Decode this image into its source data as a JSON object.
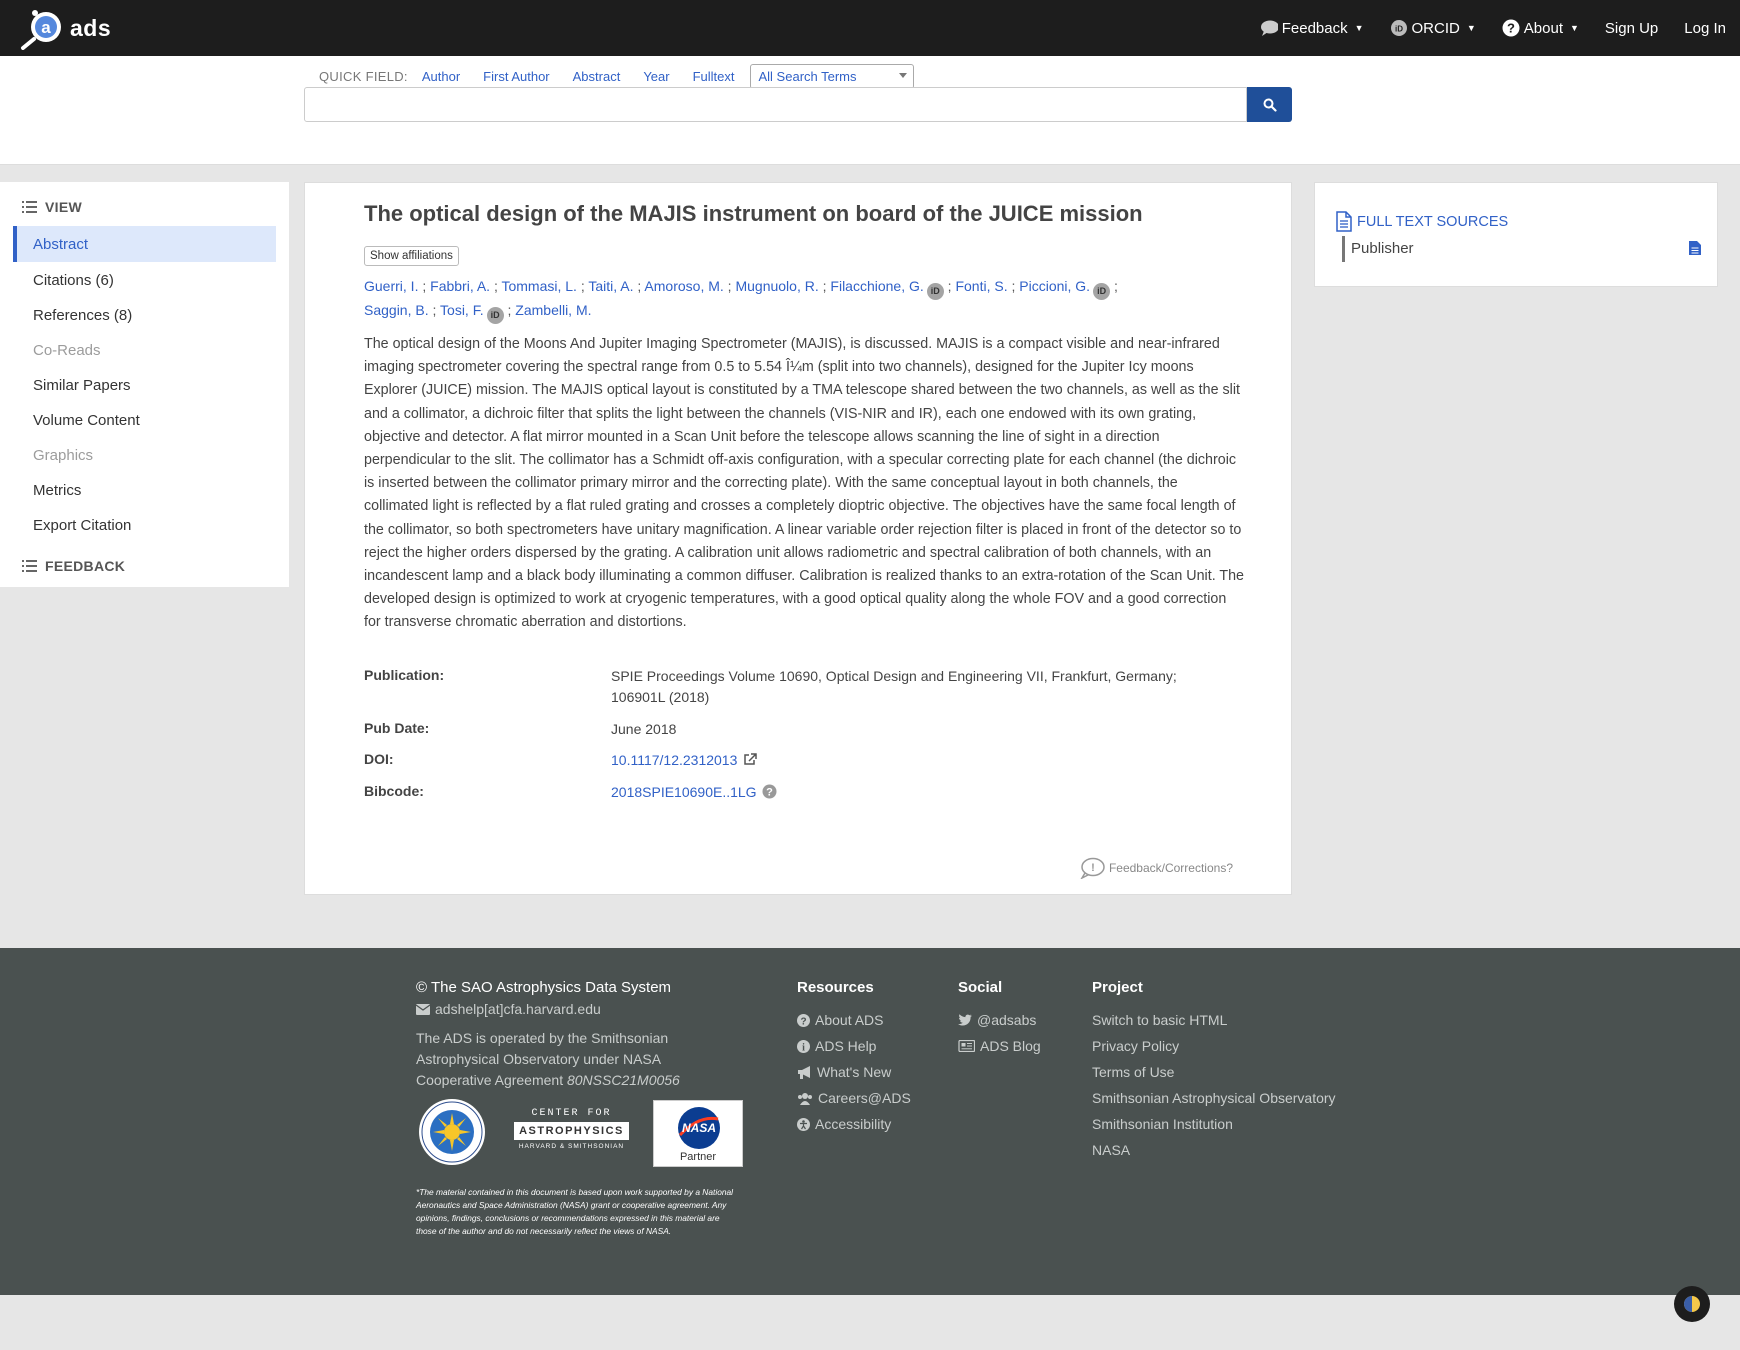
{
  "nav": {
    "logo": "ads",
    "feedback": "Feedback",
    "orcid": "ORCID",
    "about": "About",
    "signup": "Sign Up",
    "login": "Log In"
  },
  "search": {
    "quickfield_label": "QUICK FIELD:",
    "fields": [
      "Author",
      "First Author",
      "Abstract",
      "Year",
      "Fulltext"
    ],
    "select_value": "All Search Terms",
    "query": ""
  },
  "sidebar": {
    "view_heading": "VIEW",
    "feedback_heading": "FEEDBACK",
    "items": [
      {
        "label": "Abstract",
        "state": "active"
      },
      {
        "label": "Citations (6)",
        "state": "enabled"
      },
      {
        "label": "References (8)",
        "state": "enabled"
      },
      {
        "label": "Co-Reads",
        "state": "disabled"
      },
      {
        "label": "Similar Papers",
        "state": "enabled"
      },
      {
        "label": "Volume Content",
        "state": "enabled"
      },
      {
        "label": "Graphics",
        "state": "disabled"
      },
      {
        "label": "Metrics",
        "state": "enabled"
      },
      {
        "label": "Export Citation",
        "state": "enabled"
      }
    ]
  },
  "paper": {
    "title": "The optical design of the MAJIS instrument on board of the JUICE mission",
    "show_affiliations": "Show affiliations",
    "authors_line1": [
      {
        "name": "Guerri, I.",
        "orcid": false
      },
      {
        "name": "Fabbri, A.",
        "orcid": false
      },
      {
        "name": "Tommasi, L.",
        "orcid": false
      },
      {
        "name": "Taiti, A.",
        "orcid": false
      },
      {
        "name": "Amoroso, M.",
        "orcid": false
      },
      {
        "name": "Mugnuolo, R.",
        "orcid": false
      },
      {
        "name": "Filacchione, G.",
        "orcid": true
      },
      {
        "name": "Fonti, S.",
        "orcid": false
      },
      {
        "name": "Piccioni, G.",
        "orcid": true
      }
    ],
    "authors_line2": [
      {
        "name": "Saggin, B.",
        "orcid": false
      },
      {
        "name": "Tosi, F.",
        "orcid": true
      },
      {
        "name": "Zambelli, M.",
        "orcid": false
      }
    ],
    "abstract": "The optical design of the Moons And Jupiter Imaging Spectrometer (MAJIS), is discussed. MAJIS is a compact visible and near-infrared imaging spectrometer covering the spectral range from 0.5 to 5.54 Î¼m (split into two channels), designed for the Jupiter Icy moons Explorer (JUICE) mission. The MAJIS optical layout is constituted by a TMA telescope shared between the two channels, as well as the slit and a collimator, a dichroic filter that splits the light between the channels (VIS-NIR and IR), each one endowed with its own grating, objective and detector. A flat mirror mounted in a Scan Unit before the telescope allows scanning the line of sight in a direction perpendicular to the slit. The collimator has a Schmidt off-axis configuration, with a specular correcting plate for each channel (the dichroic is inserted between the collimator primary mirror and the correcting plate). With the same conceptual layout in both channels, the collimated light is reflected by a flat ruled grating and crosses a completely dioptric objective. The objectives have the same focal length of the collimator, so both spectrometers have unitary magnification. A linear variable order rejection filter is placed in front of the detector so to reject the higher orders dispersed by the grating. A calibration unit allows radiometric and spectral calibration of both channels, with an incandescent lamp and a black body illuminating a common diffuser. Calibration is realized thanks to an extra-rotation of the Scan Unit. The developed design is optimized to work at cryogenic temperatures, with a good optical quality along the whole FOV and a good correction for transverse chromatic aberration and distortions.",
    "publication_label": "Publication:",
    "publication": "SPIE Proceedings Volume 10690, Optical Design and Engineering VII, Frankfurt, Germany; 106901L (2018)",
    "pubdate_label": "Pub Date:",
    "pubdate": "June 2018",
    "doi_label": "DOI:",
    "doi": "10.1117/12.2312013",
    "bibcode_label": "Bibcode:",
    "bibcode": "2018SPIE10690E..1LG",
    "feedback_corrections": "Feedback/Corrections?"
  },
  "fulltext": {
    "heading": "FULL TEXT SOURCES",
    "source": "Publisher"
  },
  "footer": {
    "copyright": "© The SAO Astrophysics Data System",
    "email": "adshelp[at]cfa.harvard.edu",
    "operated_by": "The ADS is operated by the Smithsonian Astrophysical Observatory under NASA Cooperative Agreement ",
    "agreement": "80NSSC21M0056",
    "cfa_line1": "CENTER FOR",
    "cfa_line2": "ASTROPHYSICS",
    "cfa_line3": "HARVARD & SMITHSONIAN",
    "nasa_partner": "Partner",
    "disclaimer": "*The material contained in this document is based upon work supported by a National Aeronautics and Space Administration (NASA) grant or cooperative agreement. Any opinions, findings, conclusions or recommendations expressed in this material are those of the author and do not necessarily reflect the views of NASA.",
    "resources_heading": "Resources",
    "resources": [
      {
        "label": "About ADS",
        "icon": "question-circle-icon"
      },
      {
        "label": "ADS Help",
        "icon": "info-circle-icon"
      },
      {
        "label": "What's New",
        "icon": "bullhorn-icon"
      },
      {
        "label": "Careers@ADS",
        "icon": "users-icon"
      },
      {
        "label": "Accessibility",
        "icon": "accessibility-icon"
      }
    ],
    "social_heading": "Social",
    "social": [
      {
        "label": "@adsabs",
        "icon": "twitter-icon"
      },
      {
        "label": "ADS Blog",
        "icon": "newspaper-icon"
      }
    ],
    "project_heading": "Project",
    "project": [
      "Switch to basic HTML",
      "Privacy Policy",
      "Terms of Use",
      "Smithsonian Astrophysical Observatory",
      "Smithsonian Institution",
      "NASA"
    ]
  },
  "colors": {
    "link": "#3161c7",
    "nav_bg": "#1d1d1d",
    "search_button": "#1f4f99",
    "footer_bg": "#4a5150",
    "active_item_bg": "#dde8fb"
  }
}
